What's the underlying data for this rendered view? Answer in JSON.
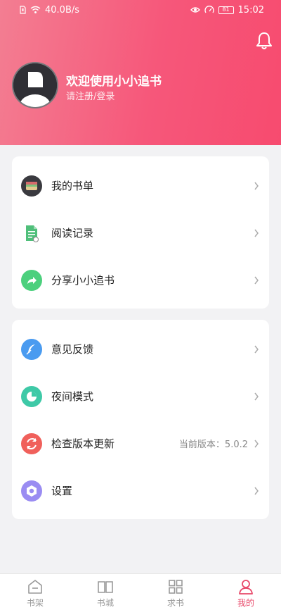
{
  "status_bar": {
    "network_speed": "40.0B/s",
    "battery": "81",
    "time": "15:02"
  },
  "profile": {
    "welcome": "欢迎使用小小追书",
    "login_prompt": "请注册/登录"
  },
  "menu_group_1": [
    {
      "label": "我的书单",
      "icon": "wallet-icon"
    },
    {
      "label": "阅读记录",
      "icon": "document-icon"
    },
    {
      "label": "分享小小追书",
      "icon": "share-icon"
    }
  ],
  "menu_group_2": [
    {
      "label": "意见反馈",
      "icon": "feather-icon"
    },
    {
      "label": "夜间模式",
      "icon": "pie-icon"
    },
    {
      "label": "检查版本更新",
      "icon": "refresh-icon",
      "extra": "当前版本：5.0.2"
    },
    {
      "label": "设置",
      "icon": "settings-icon"
    }
  ],
  "tabs": [
    {
      "label": "书架",
      "icon": "bookshelf-icon",
      "active": false
    },
    {
      "label": "书城",
      "icon": "book-icon",
      "active": false
    },
    {
      "label": "求书",
      "icon": "grid-icon",
      "active": false
    },
    {
      "label": "我的",
      "icon": "user-icon",
      "active": true
    }
  ],
  "colors": {
    "accent": "#e8496a",
    "header_start": "#f37e92",
    "header_end": "#f74b6f"
  }
}
